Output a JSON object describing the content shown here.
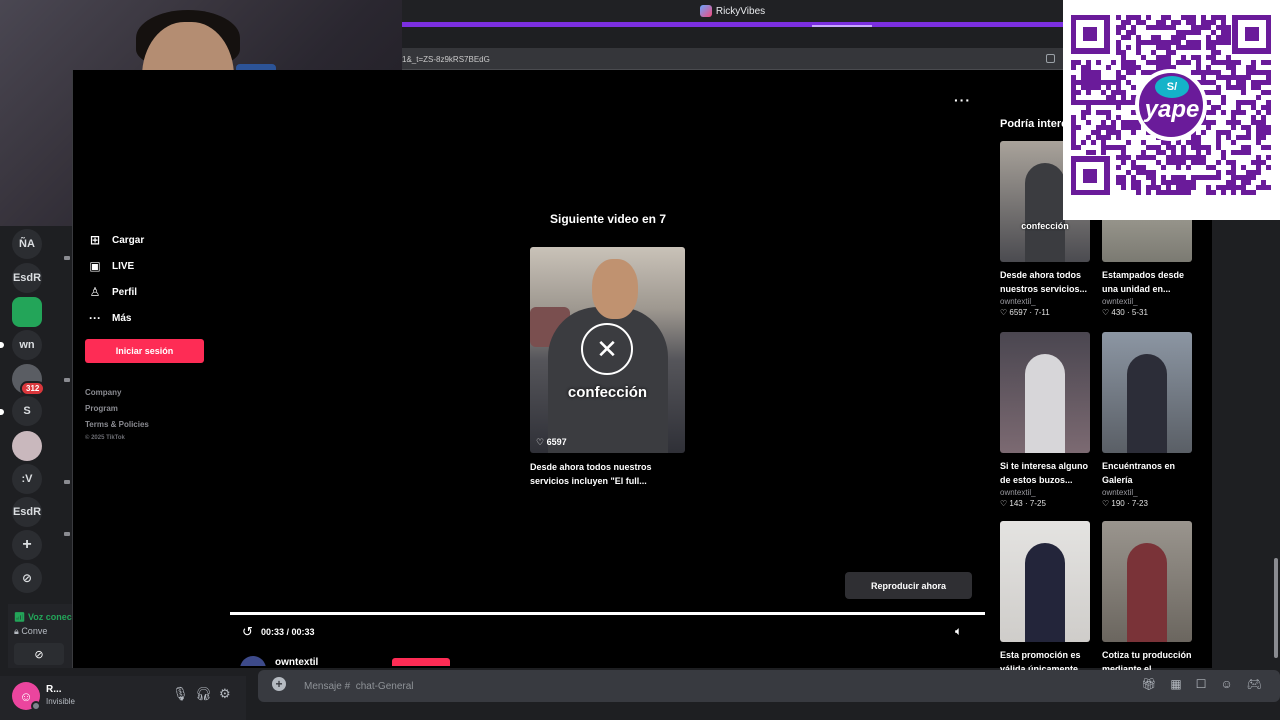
{
  "browser": {
    "tab_title": "RickyVibes",
    "url_text": "1&_t=ZS-8z9kRS7BEdG"
  },
  "discord": {
    "servers": [
      "ÑA",
      "EsdR",
      "wn",
      "S",
      ":V",
      "EsdR"
    ],
    "mention_badge": "312",
    "voice_status": "Voz conec",
    "voice_channel": "Conve",
    "user_name": "R...",
    "user_status": "Invisible",
    "message_placeholder": "Mensaje #  chat-General"
  },
  "tiktok": {
    "nav": [
      {
        "label": "Cargar",
        "icon": "upload-icon"
      },
      {
        "label": "LIVE",
        "icon": "live-icon"
      },
      {
        "label": "Perfil",
        "icon": "profile-icon"
      },
      {
        "label": "Más",
        "icon": "more-icon"
      }
    ],
    "login_label": "Iniciar sesión",
    "footer_links": [
      "Company",
      "Program",
      "Terms & Policies"
    ],
    "copyright": "© 2025 TikTok",
    "next_video_title": "Siguiente video en 7",
    "main_overlay_word": "confección",
    "main_likes": "6597",
    "main_description": "Desde ahora todos nuestros servicios incluyen \"El full...",
    "play_now_label": "Reproducir ahora",
    "playback_progress": 1.0,
    "time_display": "00:33 / 00:33",
    "author_name": "owntextil",
    "recommended_title": "Podría intere",
    "recommended": [
      {
        "title": "Desde ahora todos nuestros servicios...",
        "author": "owntextil_",
        "likes": "6597",
        "date": "7-11",
        "overlay": "confección",
        "color": "#6f6a66"
      },
      {
        "title": "Estampados desde una unidad en...",
        "author": "owntextil_",
        "likes": "430",
        "date": "5-31",
        "overlay": "",
        "color": "#8b8a82"
      },
      {
        "title": "Si te interesa alguno de estos buzos...",
        "author": "owntextil_",
        "likes": "143",
        "date": "7-25",
        "overlay": "",
        "color": "#5d5561"
      },
      {
        "title": "Encuéntranos en Galería Generación...",
        "author": "owntextil_",
        "likes": "190",
        "date": "7-23",
        "overlay": "",
        "color": "#6b7078"
      },
      {
        "title": "Esta promoción es válida únicamente...",
        "author": "",
        "likes": "",
        "date": "",
        "overlay": "",
        "color": "#d9d8d6"
      },
      {
        "title": "Cotiza tu producción mediante el número...",
        "author": "",
        "likes": "",
        "date": "",
        "overlay": "",
        "color": "#7a7570"
      }
    ]
  },
  "qr": {
    "brand": "yape",
    "currency": "S/",
    "color": "#6a1b9a"
  }
}
